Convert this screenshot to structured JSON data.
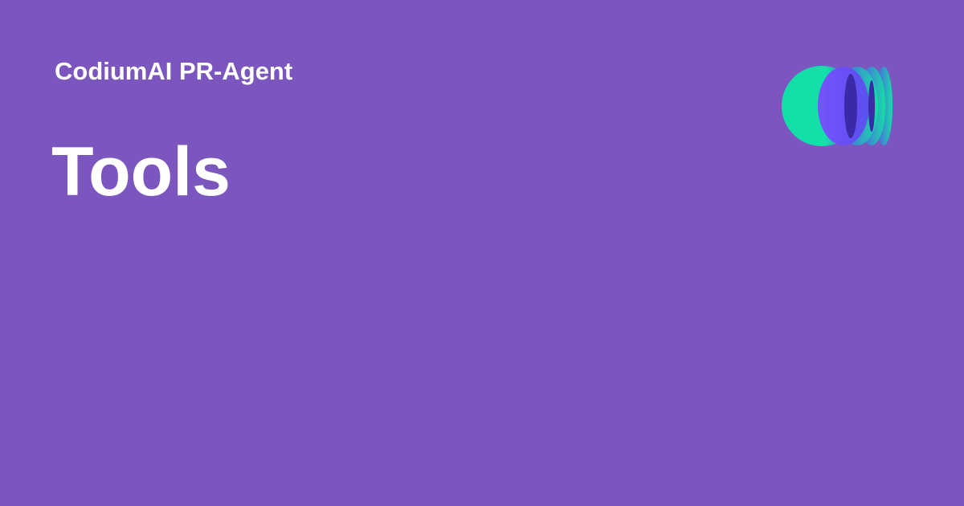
{
  "header": {
    "site_name": "CodiumAI PR-Agent"
  },
  "main": {
    "title": "Tools"
  },
  "logo": {
    "icon": "codiumai-logo-icon"
  },
  "colors": {
    "background": "#7b56bf",
    "text": "#ffffff",
    "logo_green": "#12e0a8",
    "logo_blue": "#6a4cf2",
    "logo_overlap": "#3b2aa8"
  }
}
